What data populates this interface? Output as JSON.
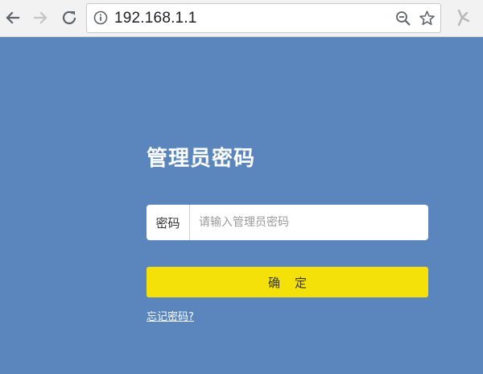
{
  "browser": {
    "url": "192.168.1.1"
  },
  "login": {
    "title": "管理员密码",
    "password_label": "密码",
    "password_placeholder": "请输入管理员密码",
    "password_value": "",
    "confirm_label": "确定",
    "forgot_link": "忘记密码?"
  },
  "colors": {
    "background": "#5b86bd",
    "button": "#f5e10a"
  }
}
